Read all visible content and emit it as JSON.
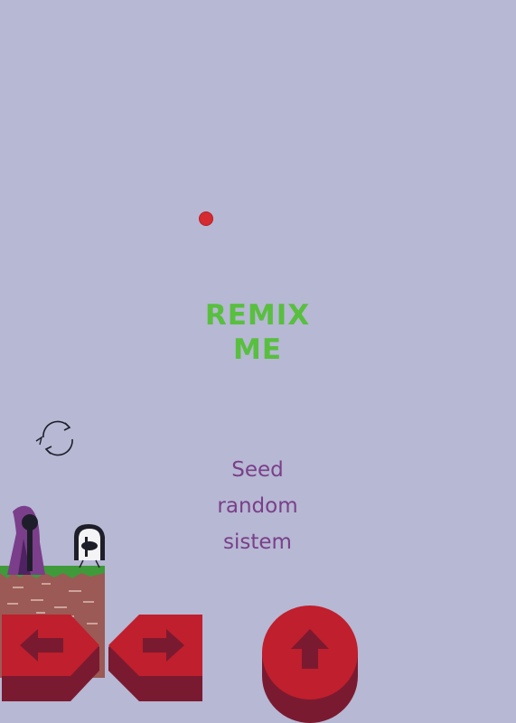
{
  "title": {
    "line1": "REMIX",
    "line2": "ME"
  },
  "subtitle": {
    "line1": "Seed",
    "line2": "random",
    "line3": "sistem"
  },
  "icons": {
    "reload": "reload-icon",
    "left": "arrow-left-icon",
    "right": "arrow-right-icon",
    "jump": "arrow-up-icon"
  },
  "colors": {
    "background": "#b6b8d4",
    "title": "#59bf3f",
    "subtitle": "#7a3f88",
    "button": "#c01f2d",
    "button_dark": "#7a1a30",
    "dot": "#d42a30"
  }
}
